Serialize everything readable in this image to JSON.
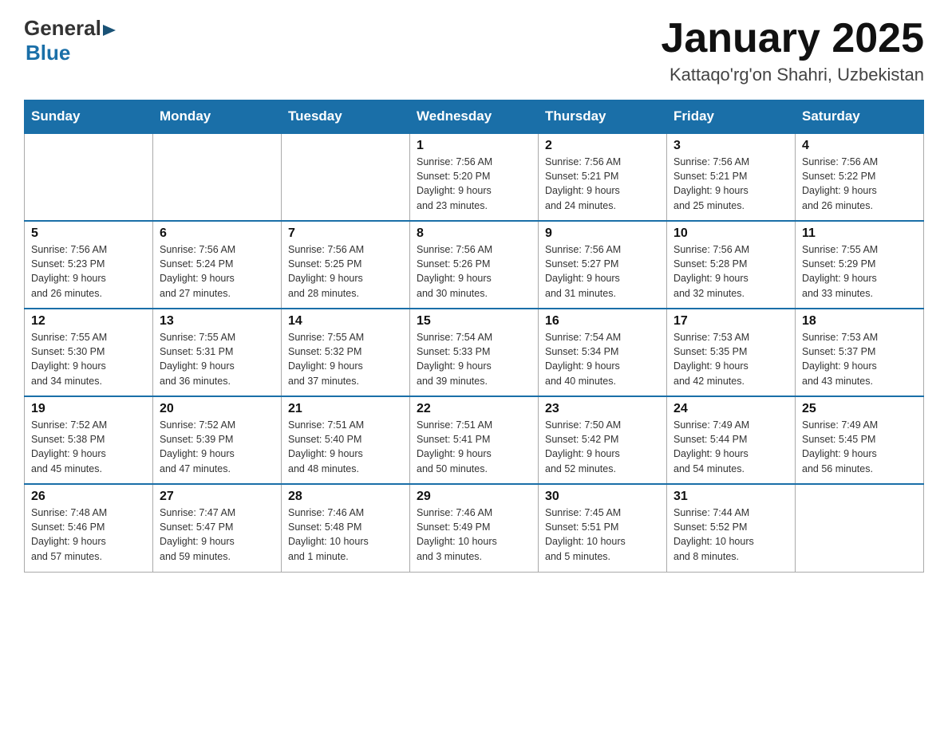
{
  "header": {
    "logo_general": "General",
    "logo_blue": "Blue",
    "month_title": "January 2025",
    "location": "Kattaqo'rg'on Shahri, Uzbekistan"
  },
  "weekdays": [
    "Sunday",
    "Monday",
    "Tuesday",
    "Wednesday",
    "Thursday",
    "Friday",
    "Saturday"
  ],
  "weeks": [
    [
      {
        "day": "",
        "info": ""
      },
      {
        "day": "",
        "info": ""
      },
      {
        "day": "",
        "info": ""
      },
      {
        "day": "1",
        "info": "Sunrise: 7:56 AM\nSunset: 5:20 PM\nDaylight: 9 hours\nand 23 minutes."
      },
      {
        "day": "2",
        "info": "Sunrise: 7:56 AM\nSunset: 5:21 PM\nDaylight: 9 hours\nand 24 minutes."
      },
      {
        "day": "3",
        "info": "Sunrise: 7:56 AM\nSunset: 5:21 PM\nDaylight: 9 hours\nand 25 minutes."
      },
      {
        "day": "4",
        "info": "Sunrise: 7:56 AM\nSunset: 5:22 PM\nDaylight: 9 hours\nand 26 minutes."
      }
    ],
    [
      {
        "day": "5",
        "info": "Sunrise: 7:56 AM\nSunset: 5:23 PM\nDaylight: 9 hours\nand 26 minutes."
      },
      {
        "day": "6",
        "info": "Sunrise: 7:56 AM\nSunset: 5:24 PM\nDaylight: 9 hours\nand 27 minutes."
      },
      {
        "day": "7",
        "info": "Sunrise: 7:56 AM\nSunset: 5:25 PM\nDaylight: 9 hours\nand 28 minutes."
      },
      {
        "day": "8",
        "info": "Sunrise: 7:56 AM\nSunset: 5:26 PM\nDaylight: 9 hours\nand 30 minutes."
      },
      {
        "day": "9",
        "info": "Sunrise: 7:56 AM\nSunset: 5:27 PM\nDaylight: 9 hours\nand 31 minutes."
      },
      {
        "day": "10",
        "info": "Sunrise: 7:56 AM\nSunset: 5:28 PM\nDaylight: 9 hours\nand 32 minutes."
      },
      {
        "day": "11",
        "info": "Sunrise: 7:55 AM\nSunset: 5:29 PM\nDaylight: 9 hours\nand 33 minutes."
      }
    ],
    [
      {
        "day": "12",
        "info": "Sunrise: 7:55 AM\nSunset: 5:30 PM\nDaylight: 9 hours\nand 34 minutes."
      },
      {
        "day": "13",
        "info": "Sunrise: 7:55 AM\nSunset: 5:31 PM\nDaylight: 9 hours\nand 36 minutes."
      },
      {
        "day": "14",
        "info": "Sunrise: 7:55 AM\nSunset: 5:32 PM\nDaylight: 9 hours\nand 37 minutes."
      },
      {
        "day": "15",
        "info": "Sunrise: 7:54 AM\nSunset: 5:33 PM\nDaylight: 9 hours\nand 39 minutes."
      },
      {
        "day": "16",
        "info": "Sunrise: 7:54 AM\nSunset: 5:34 PM\nDaylight: 9 hours\nand 40 minutes."
      },
      {
        "day": "17",
        "info": "Sunrise: 7:53 AM\nSunset: 5:35 PM\nDaylight: 9 hours\nand 42 minutes."
      },
      {
        "day": "18",
        "info": "Sunrise: 7:53 AM\nSunset: 5:37 PM\nDaylight: 9 hours\nand 43 minutes."
      }
    ],
    [
      {
        "day": "19",
        "info": "Sunrise: 7:52 AM\nSunset: 5:38 PM\nDaylight: 9 hours\nand 45 minutes."
      },
      {
        "day": "20",
        "info": "Sunrise: 7:52 AM\nSunset: 5:39 PM\nDaylight: 9 hours\nand 47 minutes."
      },
      {
        "day": "21",
        "info": "Sunrise: 7:51 AM\nSunset: 5:40 PM\nDaylight: 9 hours\nand 48 minutes."
      },
      {
        "day": "22",
        "info": "Sunrise: 7:51 AM\nSunset: 5:41 PM\nDaylight: 9 hours\nand 50 minutes."
      },
      {
        "day": "23",
        "info": "Sunrise: 7:50 AM\nSunset: 5:42 PM\nDaylight: 9 hours\nand 52 minutes."
      },
      {
        "day": "24",
        "info": "Sunrise: 7:49 AM\nSunset: 5:44 PM\nDaylight: 9 hours\nand 54 minutes."
      },
      {
        "day": "25",
        "info": "Sunrise: 7:49 AM\nSunset: 5:45 PM\nDaylight: 9 hours\nand 56 minutes."
      }
    ],
    [
      {
        "day": "26",
        "info": "Sunrise: 7:48 AM\nSunset: 5:46 PM\nDaylight: 9 hours\nand 57 minutes."
      },
      {
        "day": "27",
        "info": "Sunrise: 7:47 AM\nSunset: 5:47 PM\nDaylight: 9 hours\nand 59 minutes."
      },
      {
        "day": "28",
        "info": "Sunrise: 7:46 AM\nSunset: 5:48 PM\nDaylight: 10 hours\nand 1 minute."
      },
      {
        "day": "29",
        "info": "Sunrise: 7:46 AM\nSunset: 5:49 PM\nDaylight: 10 hours\nand 3 minutes."
      },
      {
        "day": "30",
        "info": "Sunrise: 7:45 AM\nSunset: 5:51 PM\nDaylight: 10 hours\nand 5 minutes."
      },
      {
        "day": "31",
        "info": "Sunrise: 7:44 AM\nSunset: 5:52 PM\nDaylight: 10 hours\nand 8 minutes."
      },
      {
        "day": "",
        "info": ""
      }
    ]
  ]
}
